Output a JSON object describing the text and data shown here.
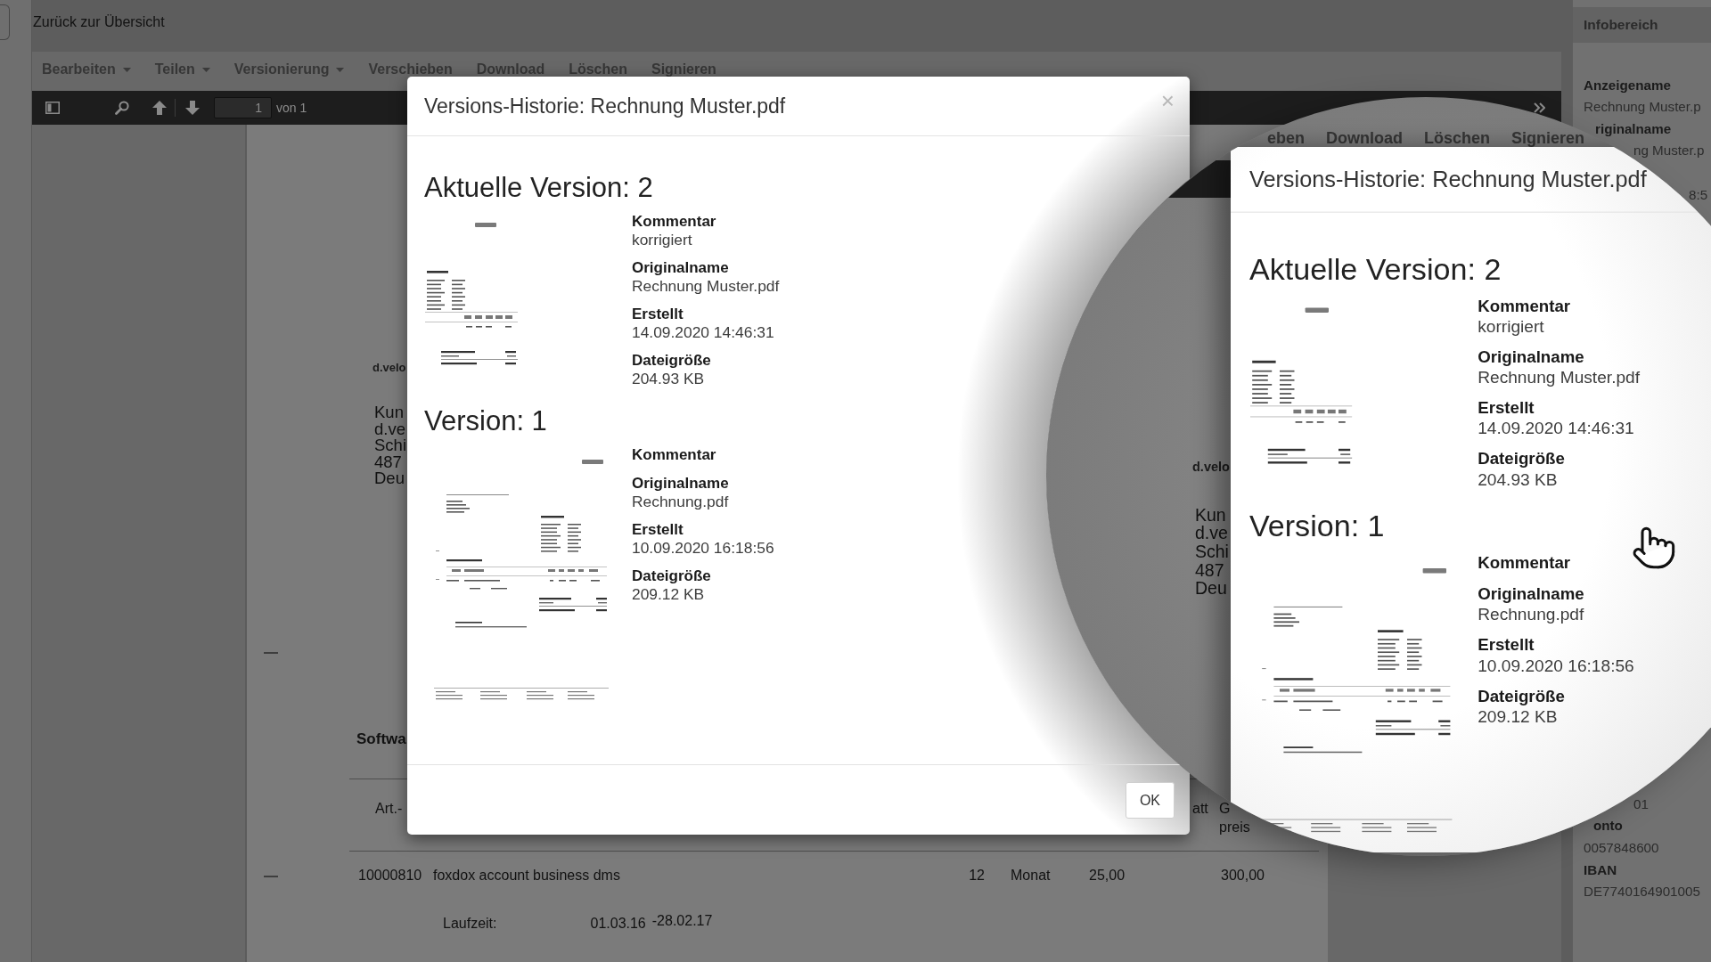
{
  "top_bar": {
    "back_link": "Zurück zur Übersicht"
  },
  "menu_bar": {
    "items": [
      {
        "label": "Bearbeiten",
        "dropdown": true
      },
      {
        "label": "Teilen",
        "dropdown": true
      },
      {
        "label": "Versionierung",
        "dropdown": true
      },
      {
        "label": "Verschieben",
        "dropdown": false
      },
      {
        "label": "Download",
        "dropdown": false
      },
      {
        "label": "Löschen",
        "dropdown": false
      },
      {
        "label": "Signieren",
        "dropdown": false
      }
    ]
  },
  "viewer_toolbar": {
    "page_number": "1",
    "page_count": "von 1"
  },
  "document": {
    "logo_text": "d.velo",
    "address_lines": [
      "Kun",
      "d.ve",
      "Schi",
      "487",
      "Deu"
    ],
    "section_title": "Softwa",
    "table": {
      "header": {
        "column_1": [
          "Art.-"
        ],
        "column_6": [
          "att"
        ],
        "column_7": [
          "G",
          "preis"
        ]
      },
      "rows": [
        {
          "column_1": "10000810",
          "column_2": "foxdox account business dms",
          "column_3": "12",
          "column_4": "Monat",
          "column_5": "25,00",
          "column_7": "300,00"
        }
      ],
      "term": {
        "label": "Laufzeit:",
        "start": "01.03.16",
        "end": "-28.02.17"
      }
    }
  },
  "info_panel": {
    "title": "Infobereich",
    "upper_fields": [
      {
        "kind": "label",
        "text": "Anzeigename"
      },
      {
        "kind": "value",
        "text": "Rechnung Muster.p"
      },
      {
        "kind": "label",
        "text": "riginalname"
      },
      {
        "kind": "value",
        "text": "ng Muster.p"
      },
      {
        "kind": "value",
        "text": "8:5"
      }
    ],
    "lower_fields": [
      {
        "kind": "value",
        "text": "01"
      },
      {
        "kind": "label",
        "text": "onto"
      },
      {
        "kind": "value",
        "text": "0057848600"
      },
      {
        "kind": "label",
        "text": "IBAN"
      },
      {
        "kind": "value",
        "text": "DE7740164901005"
      }
    ]
  },
  "dialog": {
    "title": "Versions-Historie: Rechnung Muster.pdf",
    "close": "×",
    "versions": [
      {
        "heading": "Aktuelle Version: 2",
        "kind": "excerpt",
        "fields": [
          {
            "label": "Kommentar",
            "value": "korrigiert"
          },
          {
            "label": "Originalname",
            "value": "Rechnung Muster.pdf"
          },
          {
            "label": "Erstellt",
            "value": "14.09.2020 14:46:31"
          },
          {
            "label": "Dateigröße",
            "value": "204.93 KB"
          }
        ]
      },
      {
        "heading": "Version: 1",
        "kind": "full_page",
        "fields": [
          {
            "label": "Kommentar"
          },
          {
            "label": "Originalname",
            "value": "Rechnung.pdf"
          },
          {
            "label": "Erstellt",
            "value": "10.09.2020 16:18:56"
          },
          {
            "label": "Dateigröße",
            "value": "209.12 KB"
          }
        ]
      }
    ],
    "buttons": [
      "OK"
    ]
  },
  "magnifier": {
    "menu_items": [
      "eben",
      "Download",
      "Löschen",
      "Signieren"
    ],
    "document": {
      "logo_text": "d.velo",
      "address_lines": [
        "Kun",
        "d.ve",
        "Schi",
        "487",
        "Deu"
      ]
    },
    "dialog": {
      "title": "Versions-Historie: Rechnung Muster.pdf",
      "versions": [
        {
          "heading": "Aktuelle Version: 2",
          "kind": "excerpt",
          "fields": [
            {
              "label": "Kommentar",
              "value": "korrigiert"
            },
            {
              "label": "Originalname",
              "value": "Rechnung Muster.pdf"
            },
            {
              "label": "Erstellt",
              "value": "14.09.2020 14:46:31"
            },
            {
              "label": "Dateigröße",
              "value": "204.93 KB"
            }
          ]
        },
        {
          "heading": "Version: 1",
          "kind": "full_page",
          "fields": [
            {
              "label": "Kommentar"
            },
            {
              "label": "Originalname",
              "value": "Rechnung.pdf"
            },
            {
              "label": "Erstellt",
              "value": "10.09.2020 16:18:56"
            },
            {
              "label": "Dateigröße",
              "value": "209.12 KB"
            }
          ]
        }
      ]
    }
  }
}
